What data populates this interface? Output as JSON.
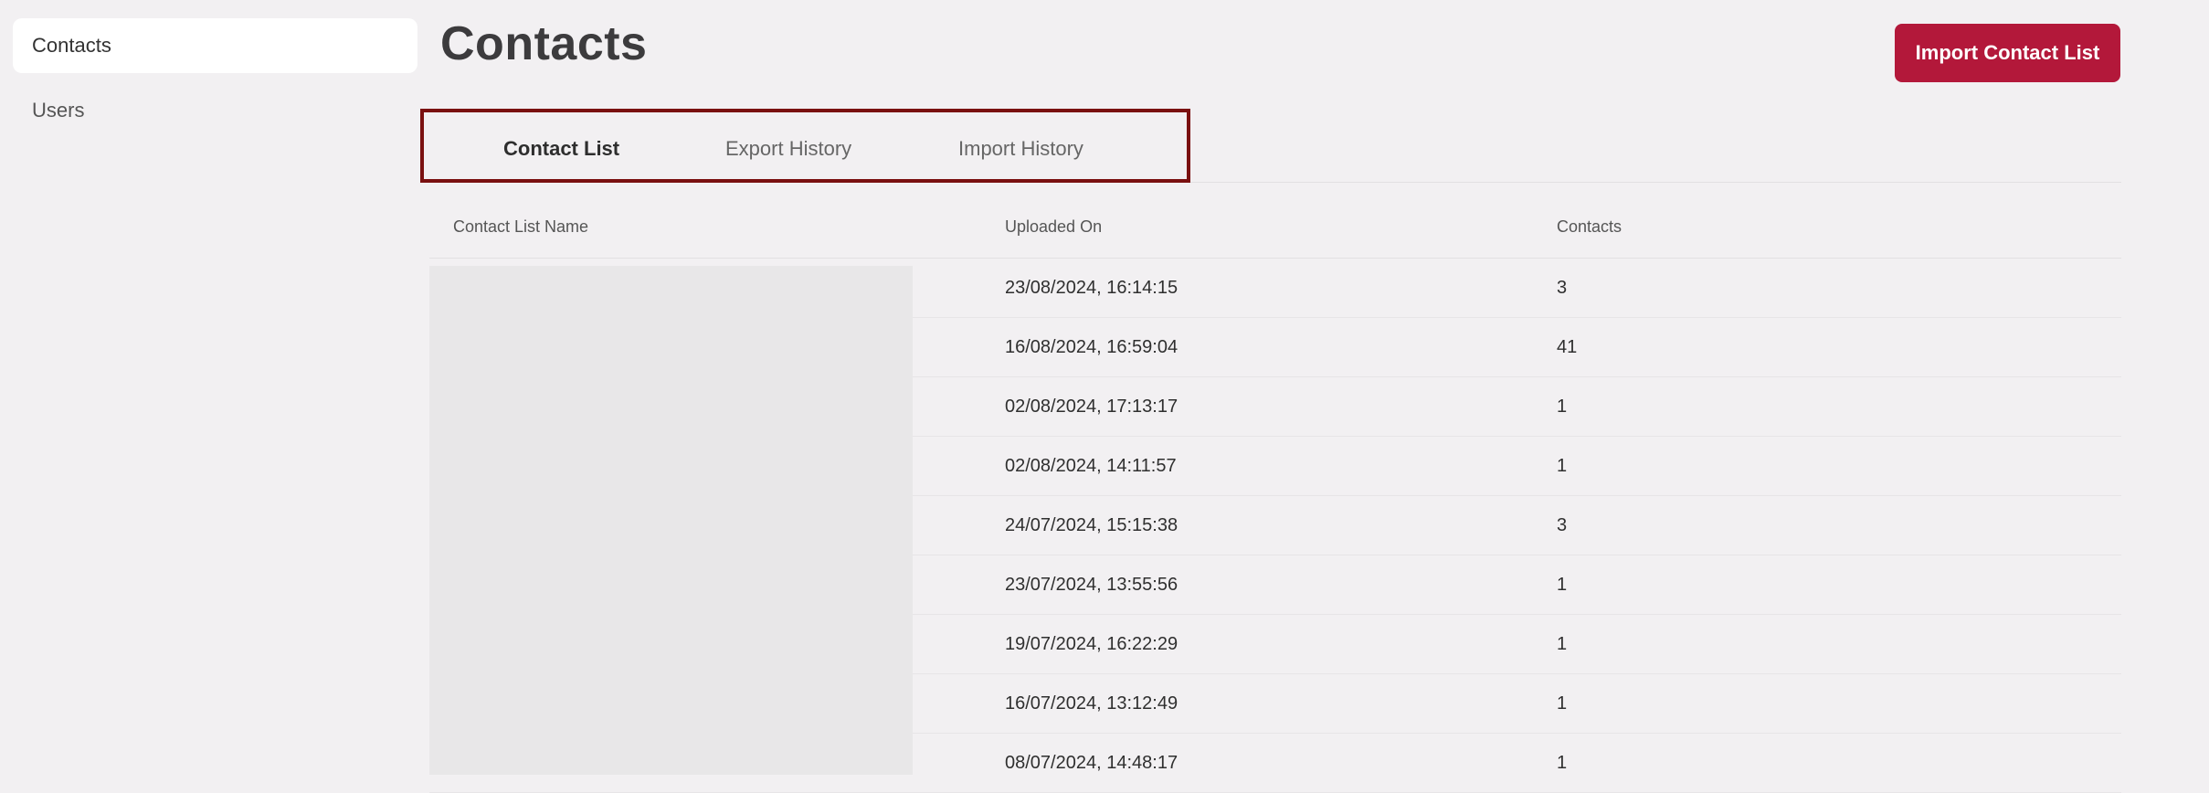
{
  "sidebar": {
    "items": [
      {
        "label": "Contacts",
        "active": true
      },
      {
        "label": "Users",
        "active": false
      }
    ]
  },
  "header": {
    "title": "Contacts",
    "import_button": "Import Contact List"
  },
  "tabs": [
    {
      "label": "Contact List",
      "active": true
    },
    {
      "label": "Export History",
      "active": false
    },
    {
      "label": "Import History",
      "active": false
    }
  ],
  "table": {
    "columns": [
      "Contact List Name",
      "Uploaded On",
      "Contacts"
    ],
    "rows": [
      {
        "uploaded_on": "23/08/2024, 16:14:15",
        "contacts": "3"
      },
      {
        "uploaded_on": "16/08/2024, 16:59:04",
        "contacts": "41"
      },
      {
        "uploaded_on": "02/08/2024, 17:13:17",
        "contacts": "1"
      },
      {
        "uploaded_on": "02/08/2024, 14:11:57",
        "contacts": "1"
      },
      {
        "uploaded_on": "24/07/2024, 15:15:38",
        "contacts": "3"
      },
      {
        "uploaded_on": "23/07/2024, 13:55:56",
        "contacts": "1"
      },
      {
        "uploaded_on": "19/07/2024, 16:22:29",
        "contacts": "1"
      },
      {
        "uploaded_on": "16/07/2024, 13:12:49",
        "contacts": "1"
      },
      {
        "uploaded_on": "08/07/2024, 14:48:17",
        "contacts": "1"
      }
    ]
  },
  "colors": {
    "accent": "#b3183a",
    "highlight_border": "#7a1010",
    "background": "#f2f0f2"
  }
}
